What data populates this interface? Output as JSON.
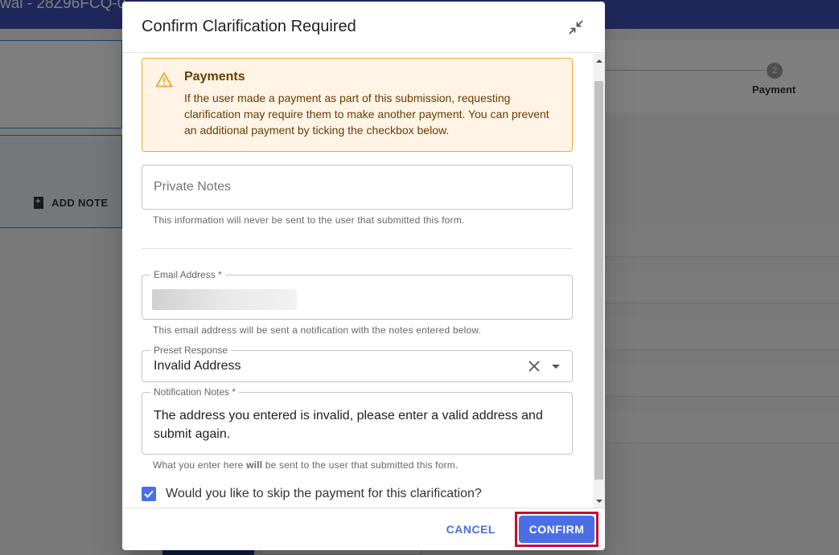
{
  "background": {
    "topbar_text": "wal - 28Z96FCQ-0",
    "add_note_label": "ADD NOTE",
    "step_number": "2",
    "step_label": "Payment"
  },
  "dialog": {
    "title": "Confirm Clarification Required",
    "collapse_icon": "collapse-arrows-icon",
    "alert": {
      "icon": "warning-icon",
      "title": "Payments",
      "text": "If the user made a payment as part of this submission, requesting clarification may require them to make another payment. You can prevent an additional payment by ticking the checkbox below.",
      "color": "#663c00",
      "border_color": "#f0a830",
      "background": "#fff4e5"
    },
    "private_notes": {
      "placeholder": "Private Notes",
      "helper": "This information will never be sent to the user that submitted this form."
    },
    "email": {
      "label": "Email Address *",
      "helper": "This email address will be sent a notification with the notes entered below."
    },
    "preset": {
      "label": "Preset Response",
      "value": "Invalid Address"
    },
    "notes": {
      "label": "Notification Notes *",
      "value": "The address you entered is invalid, please enter a valid address and submit again.",
      "helper_before": "What you enter here ",
      "helper_bold": "will",
      "helper_after": " be sent to the user that submitted this form."
    },
    "skip_payment": {
      "label": "Would you like to skip the payment for this clarification?",
      "checked": true
    },
    "footer": {
      "cancel_label": "CANCEL",
      "confirm_label": "CONFIRM",
      "accent": "#4b6ee6",
      "highlight": "#c40f2e"
    }
  }
}
